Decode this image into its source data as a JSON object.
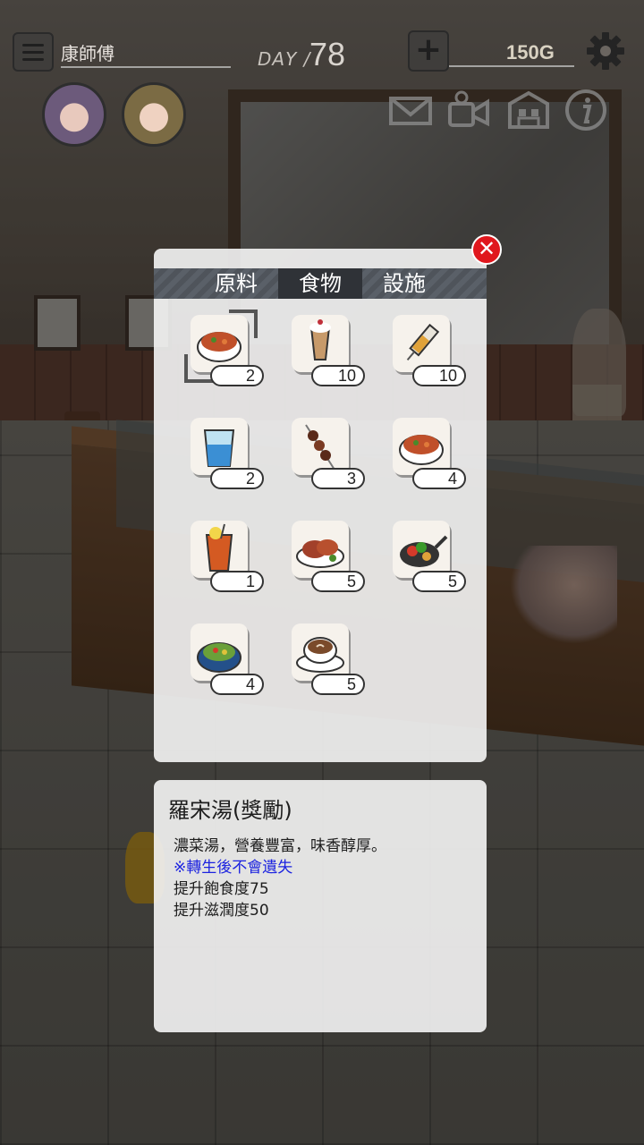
{
  "hud": {
    "player_name": "康師傅",
    "day_label": "DAY /",
    "day_value": "78",
    "gold": "150G"
  },
  "tabs": [
    {
      "label": "原料",
      "active": false
    },
    {
      "label": "食物",
      "active": true
    },
    {
      "label": "設施",
      "active": false
    }
  ],
  "items": [
    {
      "icon": "soup-bowl-icon",
      "count": "2",
      "selected": true
    },
    {
      "icon": "parfait-icon",
      "count": "10"
    },
    {
      "icon": "syringe-icon",
      "count": "10"
    },
    {
      "icon": "water-glass-icon",
      "count": "2"
    },
    {
      "icon": "kebab-skewer-icon",
      "count": "3"
    },
    {
      "icon": "soup-bowl-icon",
      "count": "4"
    },
    {
      "icon": "iced-tea-icon",
      "count": "1"
    },
    {
      "icon": "roast-meat-icon",
      "count": "5"
    },
    {
      "icon": "veggie-pan-icon",
      "count": "5"
    },
    {
      "icon": "stew-pot-icon",
      "count": "4"
    },
    {
      "icon": "coffee-cup-icon",
      "count": "5"
    }
  ],
  "detail": {
    "title": "羅宋湯(獎勵)",
    "description": "濃菜湯，營養豐富，味香醇厚。",
    "note": "※轉生後不會遺失",
    "effect1": "提升飽食度75",
    "effect2": "提升滋潤度50"
  },
  "colors": {
    "close_button": "#e0171d",
    "note_text": "#1b22e0",
    "active_tab": "#2f3237"
  }
}
